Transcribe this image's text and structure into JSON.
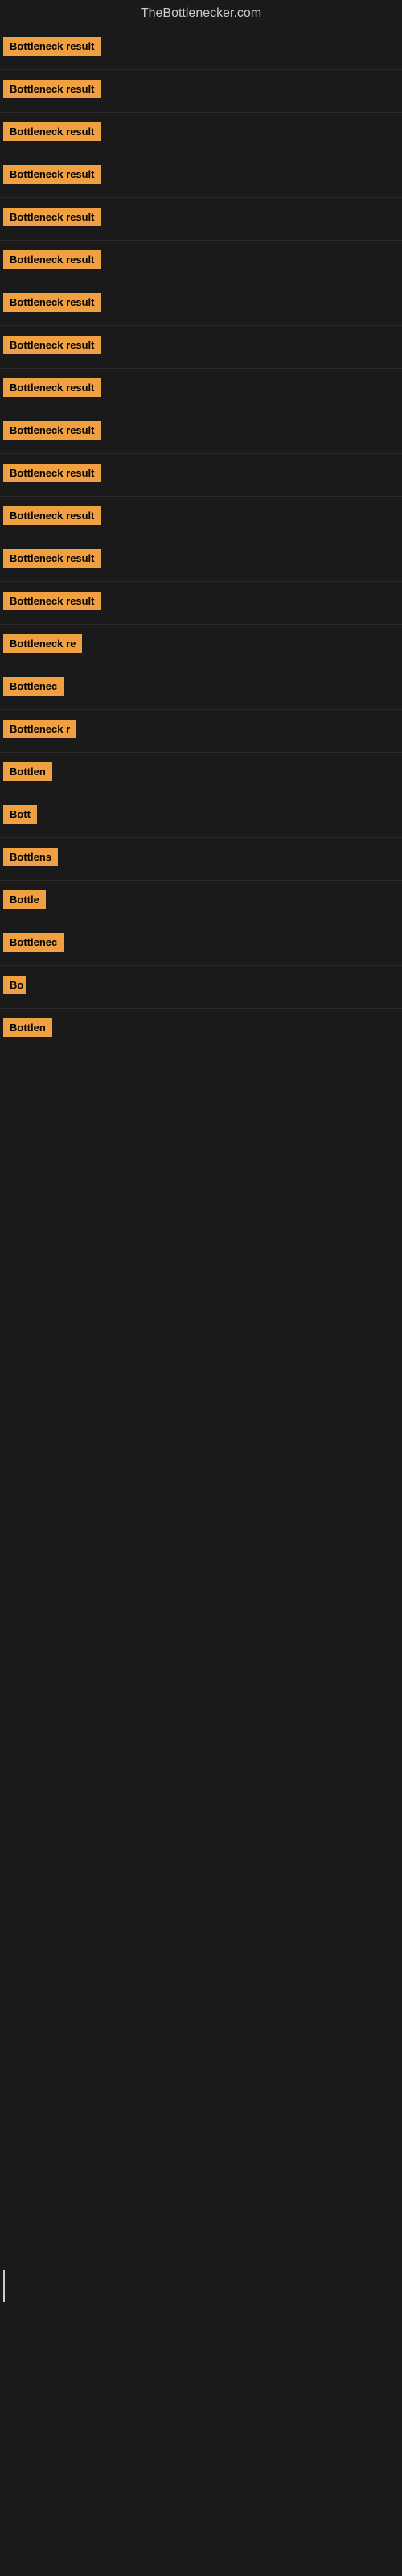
{
  "site": {
    "title": "TheBottlenecker.com"
  },
  "items": [
    {
      "label": "Bottleneck result",
      "width": 130
    },
    {
      "label": "Bottleneck result",
      "width": 130
    },
    {
      "label": "Bottleneck result",
      "width": 130
    },
    {
      "label": "Bottleneck result",
      "width": 130
    },
    {
      "label": "Bottleneck result",
      "width": 130
    },
    {
      "label": "Bottleneck result",
      "width": 130
    },
    {
      "label": "Bottleneck result",
      "width": 130
    },
    {
      "label": "Bottleneck result",
      "width": 130
    },
    {
      "label": "Bottleneck result",
      "width": 130
    },
    {
      "label": "Bottleneck result",
      "width": 130
    },
    {
      "label": "Bottleneck result",
      "width": 130
    },
    {
      "label": "Bottleneck result",
      "width": 130
    },
    {
      "label": "Bottleneck result",
      "width": 130
    },
    {
      "label": "Bottleneck result",
      "width": 130
    },
    {
      "label": "Bottleneck re",
      "width": 110
    },
    {
      "label": "Bottlenec",
      "width": 80
    },
    {
      "label": "Bottleneck r",
      "width": 95
    },
    {
      "label": "Bottlen",
      "width": 70
    },
    {
      "label": "Bott",
      "width": 45
    },
    {
      "label": "Bottlens",
      "width": 72
    },
    {
      "label": "Bottle",
      "width": 55
    },
    {
      "label": "Bottlenec",
      "width": 80
    },
    {
      "label": "Bo",
      "width": 28
    },
    {
      "label": "Bottlen",
      "width": 65
    }
  ]
}
